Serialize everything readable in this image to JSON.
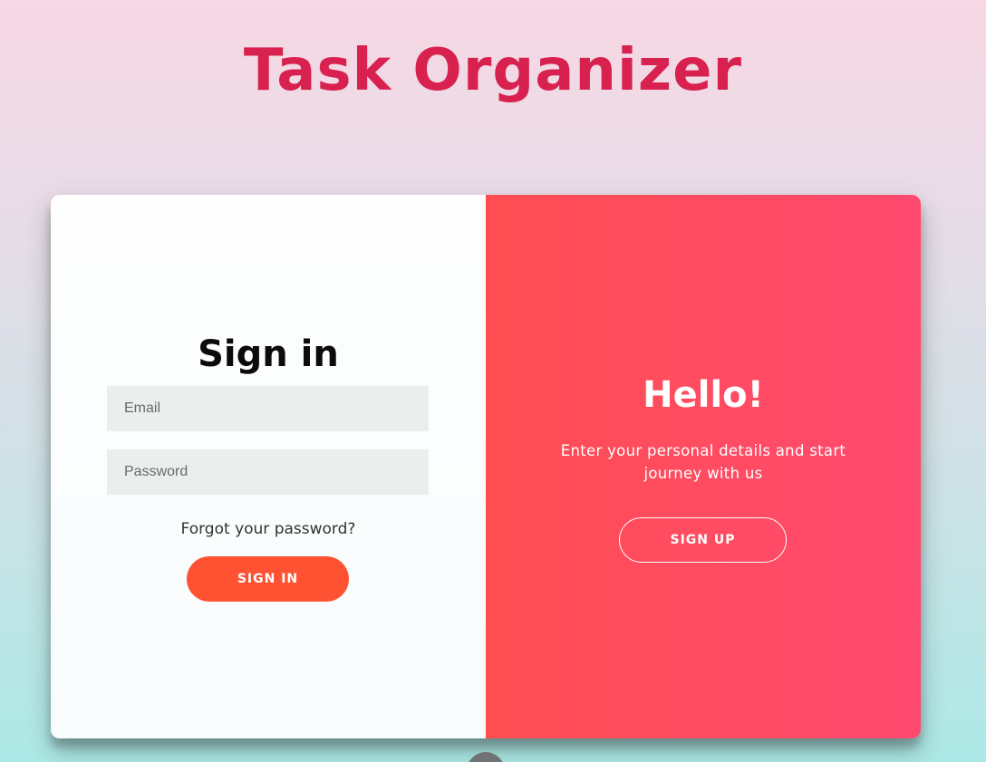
{
  "app": {
    "title": "Task Organizer"
  },
  "signin": {
    "title": "Sign in",
    "email_placeholder": "Email",
    "password_placeholder": "Password",
    "forgot_label": "Forgot your password?",
    "button_label": "SIGN IN"
  },
  "overlay": {
    "title": "Hello!",
    "text": "Enter your personal details and start journey with us",
    "button_label": "SIGN UP"
  },
  "colors": {
    "title": "#d8214f",
    "accent_button": "#ff5233",
    "overlay_start": "#ff4d52",
    "overlay_end": "#ff4a70"
  }
}
